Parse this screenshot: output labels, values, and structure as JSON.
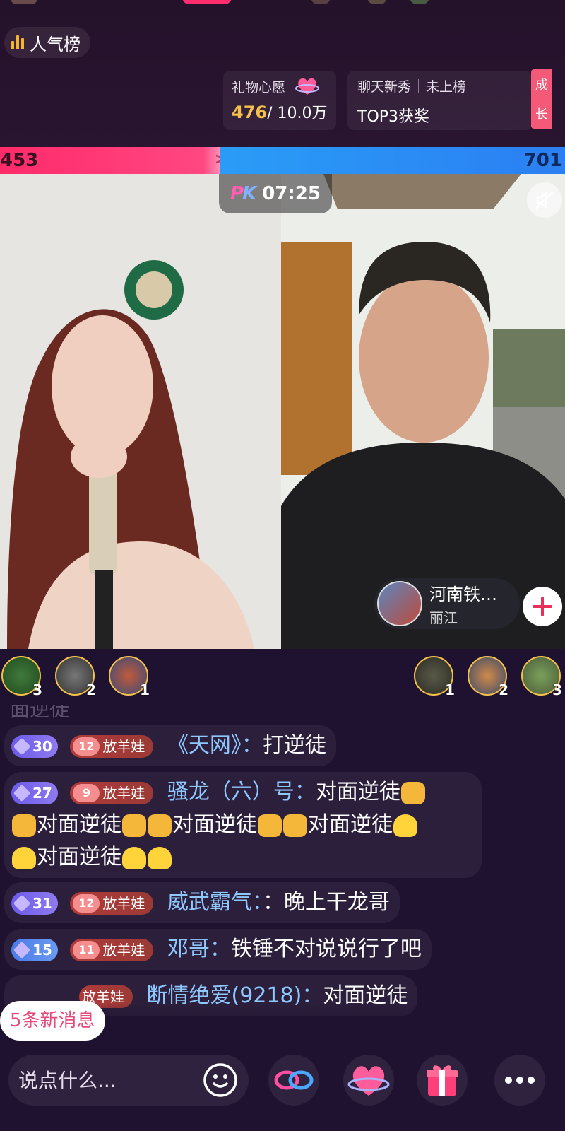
{
  "top": {
    "rank_label": "人气榜",
    "wish": {
      "title": "礼物心愿",
      "current": "476",
      "target": "/ 10.0万"
    },
    "chat": {
      "title": "聊天新秀",
      "status": "未上榜",
      "reward": "TOP3获奖"
    },
    "grow_tab": [
      "成",
      "长"
    ]
  },
  "pk": {
    "left_score": "453",
    "right_score": "701",
    "logo": "PK",
    "timer": "07:25",
    "left_fraction": 0.39
  },
  "opponent": {
    "name": "河南铁…",
    "location": "丽江"
  },
  "supporters": {
    "left": [
      "3",
      "2",
      "1"
    ],
    "right": [
      "1",
      "2",
      "3"
    ]
  },
  "chat": {
    "cut_text": "面逆徒",
    "messages": [
      {
        "level": "30",
        "fan_level": "12",
        "fan_name": "放羊娃",
        "user": "《天网》：",
        "text": "打逆徒"
      },
      {
        "level": "27",
        "fan_level": "9",
        "fan_name": "放羊娃",
        "user": "骚龙（六）号：",
        "text": "对面逆徒",
        "line2": "对面逆徒",
        "line2b": "对面逆徒",
        "line2c": "对面逆徒",
        "line3": "对面逆徒"
      },
      {
        "level": "31",
        "fan_level": "12",
        "fan_name": "放羊娃",
        "user": "威武霸气：",
        "text": "：晚上干龙哥"
      },
      {
        "level": "15",
        "fan_level": "11",
        "fan_name": "放羊娃",
        "user": "邓哥：",
        "text": "铁锤不对说说行了吧"
      },
      {
        "level": "",
        "fan_level": "",
        "fan_name": "放羊娃",
        "user": "断情绝爱(9218)：",
        "text": "对面逆徒"
      }
    ],
    "new_messages": "5条新消息"
  },
  "bottom": {
    "input_placeholder": "说点什么..."
  },
  "colors": {
    "pk_red": "#ff2a6a",
    "pk_blue": "#2a9cf7",
    "username": "#8fc7ff",
    "gold": "#f4c14b"
  }
}
